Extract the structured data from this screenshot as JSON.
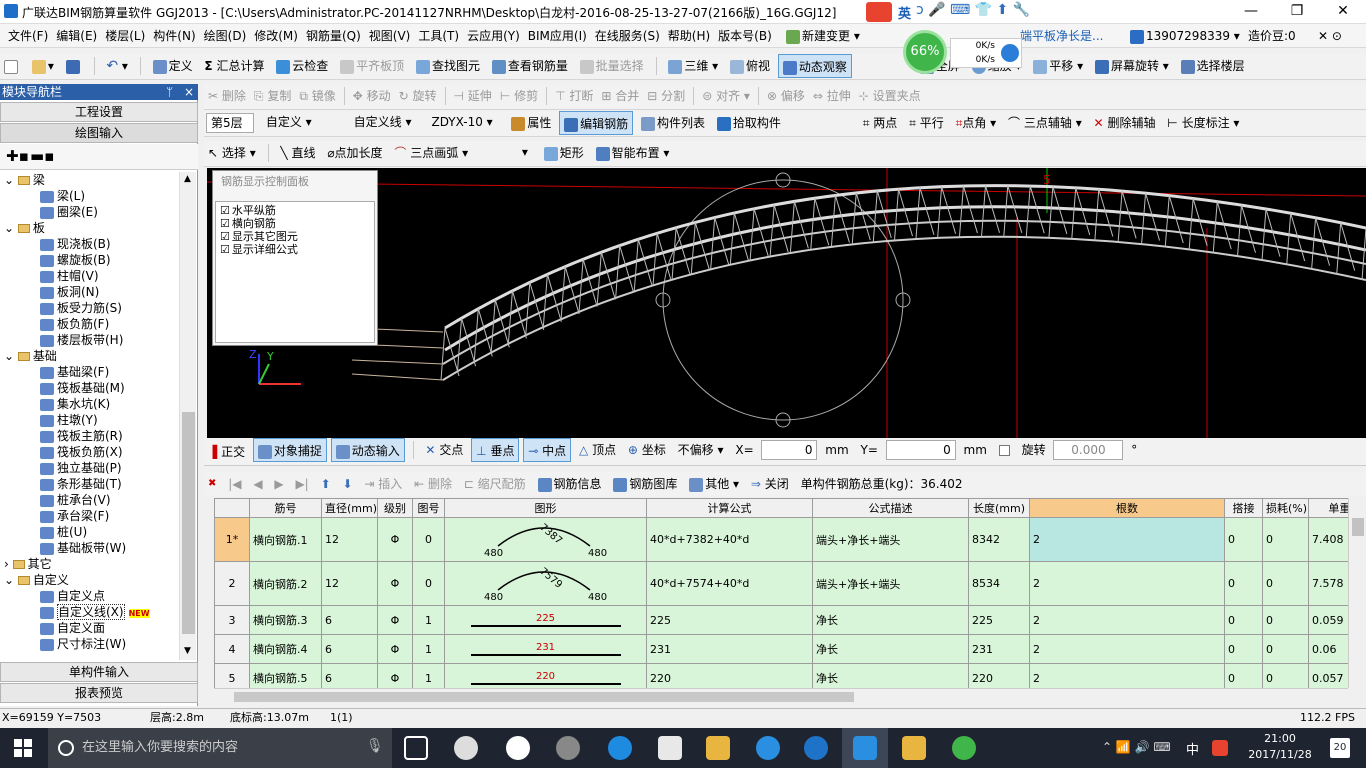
{
  "window": {
    "title": "广联达BIM钢筋算量软件 GGJ2013 - [C:\\Users\\Administrator.PC-20141127NRHM\\Desktop\\白龙村-2016-08-25-13-27-07(2166版)_16G.GGJ12]",
    "minimize": "—",
    "maximize": "❐",
    "close": "✕"
  },
  "ime": {
    "label": "英",
    "network_up": "0K/s",
    "network_down": "0K/s",
    "cpu": "66%"
  },
  "menu": [
    "文件(F)",
    "编辑(E)",
    "楼层(L)",
    "构件(N)",
    "绘图(D)",
    "修改(M)",
    "钢筋量(Q)",
    "视图(V)",
    "工具(T)",
    "云应用(Y)",
    "BIM应用(I)",
    "在线服务(S)",
    "帮助(H)",
    "版本号(B)"
  ],
  "menu_right": {
    "new_change": "新建变更",
    "phone": "13907298339",
    "beans": "造价豆:0",
    "ad_text": "端平板净长是..."
  },
  "toolbar1": [
    "定义",
    "汇总计算",
    "云检查",
    "平齐板顶",
    "查找图元",
    "查看钢筋量",
    "批量选择",
    "三维",
    "俯视",
    "动态观察",
    "全屏",
    "缩放",
    "平移",
    "屏幕旋转",
    "选择楼层"
  ],
  "toolbar2": [
    "删除",
    "复制",
    "镜像",
    "移动",
    "旋转",
    "延伸",
    "修剪",
    "打断",
    "合并",
    "分割",
    "对齐",
    "偏移",
    "拉伸",
    "设置夹点"
  ],
  "toolbar3": {
    "floor": "第5层",
    "type": "自定义",
    "subtype": "自定义线",
    "name": "ZDYX-10",
    "attr": "属性",
    "edit_rebar": "编辑钢筋",
    "list": "构件列表",
    "pick": "拾取构件",
    "two_point": "两点",
    "parallel": "平行",
    "angle": "点角",
    "three_axis": "三点辅轴",
    "del_axis": "删除辅轴",
    "dim": "长度标注"
  },
  "toolbar4": [
    "选择",
    "直线",
    "点加长度",
    "三点画弧",
    "矩形",
    "智能布置"
  ],
  "nav": {
    "header": "模块导航栏",
    "pin": "ᛘ",
    "close": "×",
    "btn_settings": "工程设置",
    "btn_draw": "绘图输入",
    "btn_single": "单构件输入",
    "btn_report": "报表预览",
    "tree": [
      {
        "t": "梁",
        "lvl": 0,
        "f": true
      },
      {
        "t": "梁(L)",
        "lvl": 1
      },
      {
        "t": "圈梁(E)",
        "lvl": 1
      },
      {
        "t": "板",
        "lvl": 0,
        "f": true
      },
      {
        "t": "现浇板(B)",
        "lvl": 1
      },
      {
        "t": "螺旋板(B)",
        "lvl": 1
      },
      {
        "t": "柱帽(V)",
        "lvl": 1
      },
      {
        "t": "板洞(N)",
        "lvl": 1
      },
      {
        "t": "板受力筋(S)",
        "lvl": 1
      },
      {
        "t": "板负筋(F)",
        "lvl": 1
      },
      {
        "t": "楼层板带(H)",
        "lvl": 1
      },
      {
        "t": "基础",
        "lvl": 0,
        "f": true
      },
      {
        "t": "基础梁(F)",
        "lvl": 1
      },
      {
        "t": "筏板基础(M)",
        "lvl": 1
      },
      {
        "t": "集水坑(K)",
        "lvl": 1
      },
      {
        "t": "柱墩(Y)",
        "lvl": 1
      },
      {
        "t": "筏板主筋(R)",
        "lvl": 1
      },
      {
        "t": "筏板负筋(X)",
        "lvl": 1
      },
      {
        "t": "独立基础(P)",
        "lvl": 1
      },
      {
        "t": "条形基础(T)",
        "lvl": 1
      },
      {
        "t": "桩承台(V)",
        "lvl": 1
      },
      {
        "t": "承台梁(F)",
        "lvl": 1
      },
      {
        "t": "桩(U)",
        "lvl": 1
      },
      {
        "t": "基础板带(W)",
        "lvl": 1
      },
      {
        "t": "其它",
        "lvl": 0,
        "f": true
      },
      {
        "t": "自定义",
        "lvl": 0,
        "f": true
      },
      {
        "t": "自定义点",
        "lvl": 1
      },
      {
        "t": "自定义线(X)",
        "lvl": 1,
        "sel": true
      },
      {
        "t": "自定义面",
        "lvl": 1
      },
      {
        "t": "尺寸标注(W)",
        "lvl": 1
      }
    ],
    "new_badge": "NEW"
  },
  "ctrlpanel": {
    "title": "钢筋显示控制面板",
    "items": [
      "水平纵筋",
      "横向钢筋",
      "显示其它图元",
      "显示详细公式"
    ]
  },
  "canvas": {
    "axis_label": "5",
    "z": "Z",
    "y": "Y"
  },
  "snapbar": {
    "ortho": "正交",
    "snap": "对象捕捉",
    "dyn": "动态输入",
    "cross": "交点",
    "perp": "垂点",
    "mid": "中点",
    "vertex": "顶点",
    "coord": "坐标",
    "offset": "不偏移",
    "x_label": "X=",
    "x_val": "0",
    "y_label": "Y=",
    "y_val": "0",
    "mm": "mm",
    "rotate": "旋转",
    "rot_val": "0.000",
    "deg": "°"
  },
  "gridtb": {
    "insert": "插入",
    "delete": "删除",
    "scale": "缩尺配筋",
    "info": "钢筋信息",
    "lib": "钢筋图库",
    "other": "其他",
    "close": "关闭",
    "total": "单构件钢筋总重(kg)：36.402"
  },
  "table": {
    "headers": [
      "",
      "筋号",
      "直径(mm)",
      "级别",
      "图号",
      "图形",
      "计算公式",
      "公式描述",
      "长度(mm)",
      "根数",
      "搭接",
      "损耗(%)",
      "单重("
    ],
    "rows": [
      [
        "1*",
        "横向钢筋.1",
        "12",
        "Φ",
        "0",
        "",
        "40*d+7382+40*d",
        "端头+净长+端头",
        "8342",
        "2",
        "0",
        "0",
        "7.408"
      ],
      [
        "2",
        "横向钢筋.2",
        "12",
        "Φ",
        "0",
        "",
        "40*d+7574+40*d",
        "端头+净长+端头",
        "8534",
        "2",
        "0",
        "0",
        "7.578"
      ],
      [
        "3",
        "横向钢筋.3",
        "6",
        "Φ",
        "1",
        "",
        "225",
        "净长",
        "225",
        "2",
        "0",
        "0",
        "0.059"
      ],
      [
        "4",
        "横向钢筋.4",
        "6",
        "Φ",
        "1",
        "",
        "231",
        "净长",
        "231",
        "2",
        "0",
        "0",
        "0.06"
      ],
      [
        "5",
        "横向钢筋.5",
        "6",
        "Φ",
        "1",
        "",
        "220",
        "净长",
        "220",
        "2",
        "0",
        "0",
        "0.057"
      ]
    ],
    "shape1": {
      "left": "480",
      "mid": "7387",
      "right": "480"
    },
    "shape2": {
      "left": "480",
      "mid": "7579",
      "right": "480"
    },
    "shape3": "225",
    "shape4": "231",
    "shape5": "220"
  },
  "status": {
    "coords": "X=69159 Y=7503",
    "height": "层高:2.8m",
    "base": "底标高:13.07m",
    "count": "1(1)",
    "fps": "112.2 FPS"
  },
  "taskbar": {
    "search": "在这里输入你要搜索的内容",
    "time": "21:00",
    "date": "2017/11/28",
    "lang": "中",
    "notify": "20"
  }
}
